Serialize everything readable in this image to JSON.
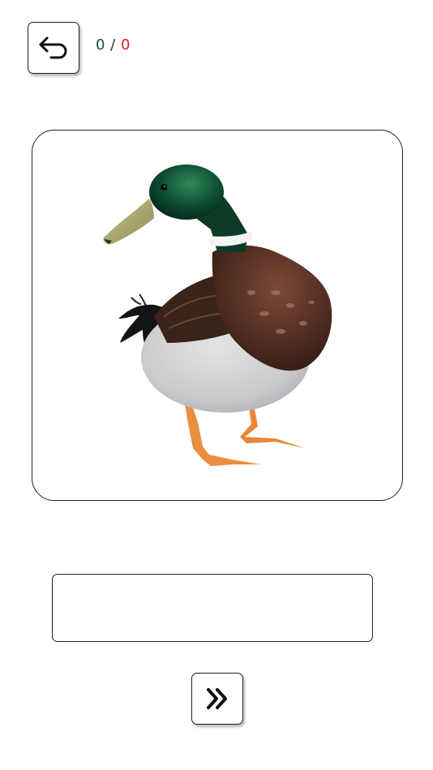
{
  "header": {
    "back_icon": "undo-arrow-icon",
    "score": {
      "correct": "0",
      "separator": " / ",
      "wrong": "0",
      "correct_color": "#0b5a2a",
      "wrong_color": "#e02020"
    }
  },
  "card": {
    "image": "mallard-duck-illustration"
  },
  "answer": {
    "value": "",
    "placeholder": ""
  },
  "footer": {
    "next_icon": "double-chevron-right-icon"
  }
}
